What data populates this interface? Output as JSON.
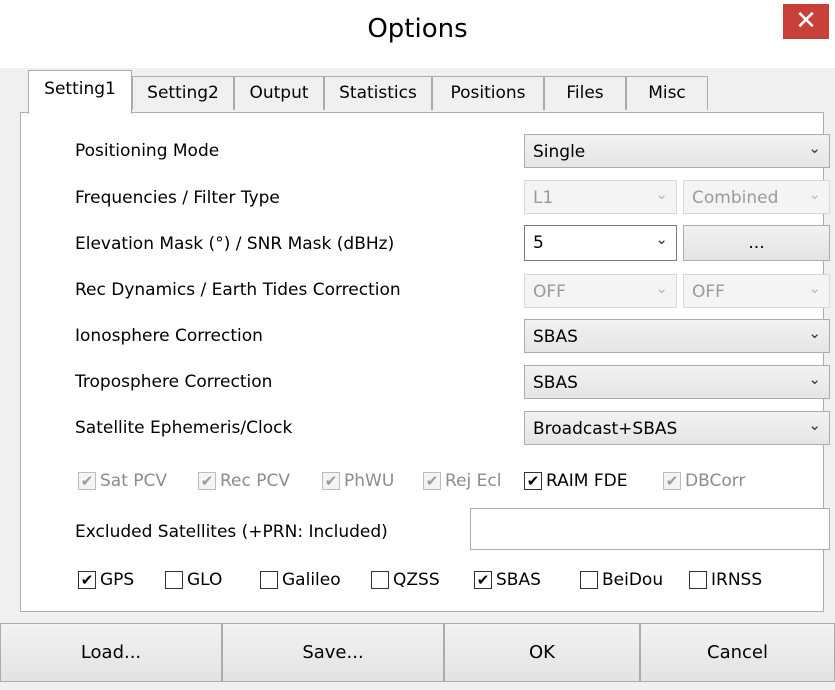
{
  "window": {
    "title": "Options",
    "close_glyph": "✕"
  },
  "tabs": [
    {
      "label": "Setting1",
      "active": true
    },
    {
      "label": "Setting2",
      "active": false
    },
    {
      "label": "Output",
      "active": false
    },
    {
      "label": "Statistics",
      "active": false
    },
    {
      "label": "Positions",
      "active": false
    },
    {
      "label": "Files",
      "active": false
    },
    {
      "label": "Misc",
      "active": false
    }
  ],
  "settings": {
    "positioning_mode": {
      "label": "Positioning Mode",
      "value": "Single"
    },
    "frequencies": {
      "label": "Frequencies / Filter Type",
      "freq_value": "L1",
      "filter_value": "Combined"
    },
    "elevation": {
      "label": "Elevation Mask (°) / SNR Mask (dBHz)",
      "value": "5",
      "snr_button": "..."
    },
    "rec_dynamics": {
      "label": "Rec Dynamics / Earth Tides Correction",
      "dyn_value": "OFF",
      "tides_value": "OFF"
    },
    "ionosphere": {
      "label": "Ionosphere Correction",
      "value": "SBAS"
    },
    "troposphere": {
      "label": "Troposphere Correction",
      "value": "SBAS"
    },
    "ephemeris": {
      "label": "Satellite Ephemeris/Clock",
      "value": "Broadcast+SBAS"
    }
  },
  "options": [
    {
      "label": "Sat PCV",
      "checked": true,
      "enabled": false
    },
    {
      "label": "Rec PCV",
      "checked": true,
      "enabled": false
    },
    {
      "label": "PhWU",
      "checked": true,
      "enabled": false
    },
    {
      "label": "Rej Ecl",
      "checked": true,
      "enabled": false
    },
    {
      "label": "RAIM FDE",
      "checked": true,
      "enabled": true
    },
    {
      "label": "DBCorr",
      "checked": true,
      "enabled": false
    }
  ],
  "excluded": {
    "label": "Excluded Satellites (+PRN: Included)",
    "value": ""
  },
  "systems": [
    {
      "label": "GPS",
      "checked": true
    },
    {
      "label": "GLO",
      "checked": false
    },
    {
      "label": "Galileo",
      "checked": false
    },
    {
      "label": "QZSS",
      "checked": false
    },
    {
      "label": "SBAS",
      "checked": true
    },
    {
      "label": "BeiDou",
      "checked": false
    },
    {
      "label": "IRNSS",
      "checked": false
    }
  ],
  "footer": {
    "load": "Load...",
    "save": "Save...",
    "ok": "OK",
    "cancel": "Cancel"
  },
  "icons": {
    "dropdown": "chevron-down-icon",
    "check": "checkmark-icon"
  },
  "colors": {
    "close_button": "#c7413a",
    "dialog_bg": "#f0f0f0",
    "panel_bg": "#ffffff"
  }
}
